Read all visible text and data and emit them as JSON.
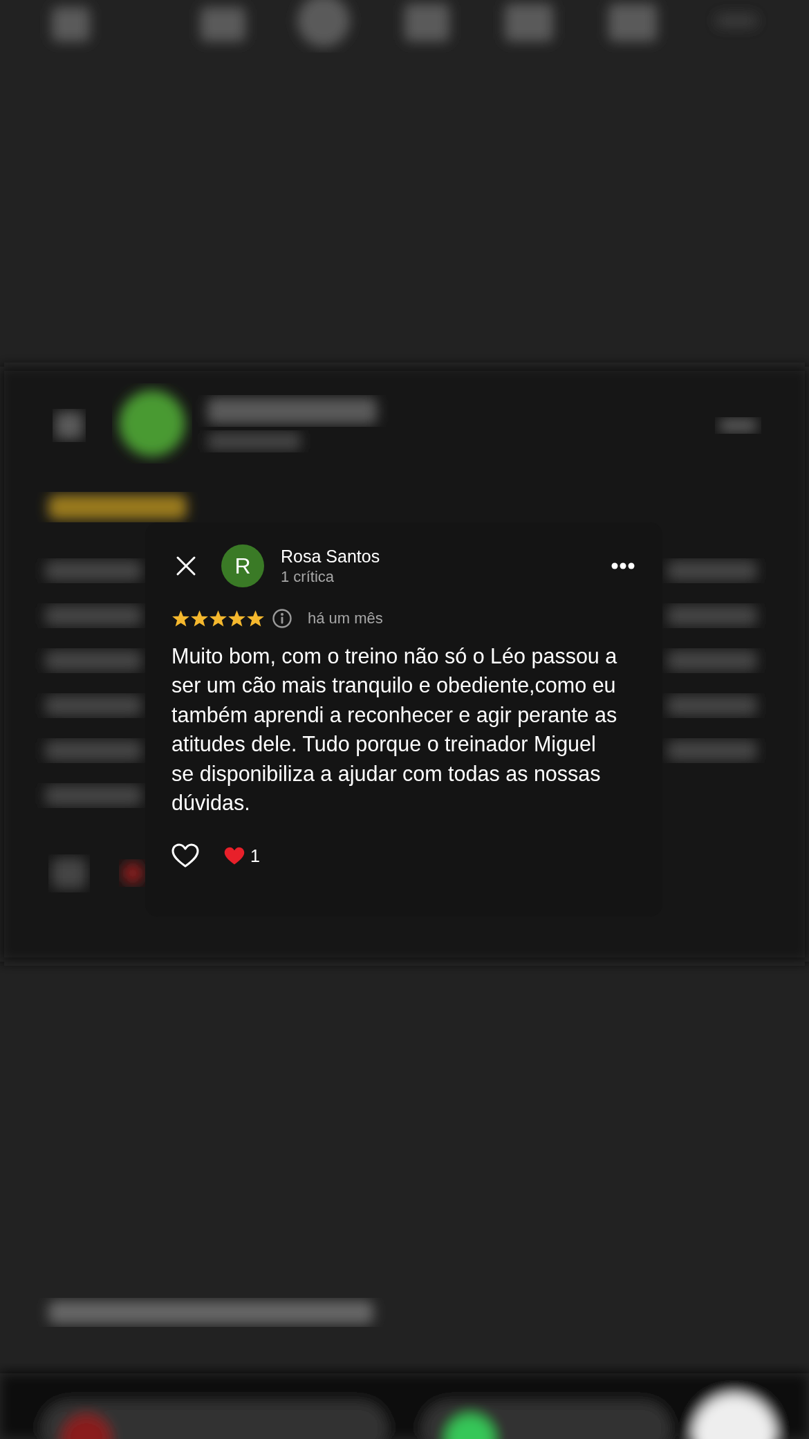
{
  "review": {
    "avatar_letter": "R",
    "name": "Rosa Santos",
    "subtitle": "1 crítica",
    "stars": 5,
    "time": "há um mês",
    "body": "Muito bom, com o treino não só o Léo passou a ser um cão mais tranquilo e obediente,como eu também aprendi a reconhecer e agir perante as atitudes dele. Tudo porque o treinador Miguel se disponibiliza a ajudar com todas as nossas dúvidas.",
    "liked": false,
    "reaction_count": "1"
  }
}
